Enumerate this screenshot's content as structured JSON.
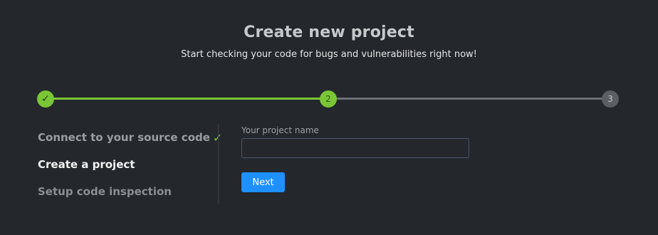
{
  "header": {
    "title": "Create new project",
    "subtitle": "Start checking your code for bugs and vulnerabilities right now!"
  },
  "stepper": {
    "steps": [
      {
        "marker": "✓",
        "state": "completed"
      },
      {
        "marker": "2",
        "state": "active"
      },
      {
        "marker": "3",
        "state": "pending"
      }
    ],
    "colors": {
      "complete": "#7ac636",
      "pending": "#6d7075"
    }
  },
  "steps_list": [
    {
      "label": "Connect to your source code",
      "check": "✓",
      "state": "completed"
    },
    {
      "label": "Create a project",
      "state": "active"
    },
    {
      "label": "Setup code inspection",
      "state": "pending"
    }
  ],
  "form": {
    "project_name_label": "Your project name",
    "project_name_value": "",
    "project_name_placeholder": "",
    "next_label": "Next"
  },
  "colors": {
    "background": "#24272c",
    "accent_green": "#7ac636",
    "primary_button": "#1e90ff"
  }
}
